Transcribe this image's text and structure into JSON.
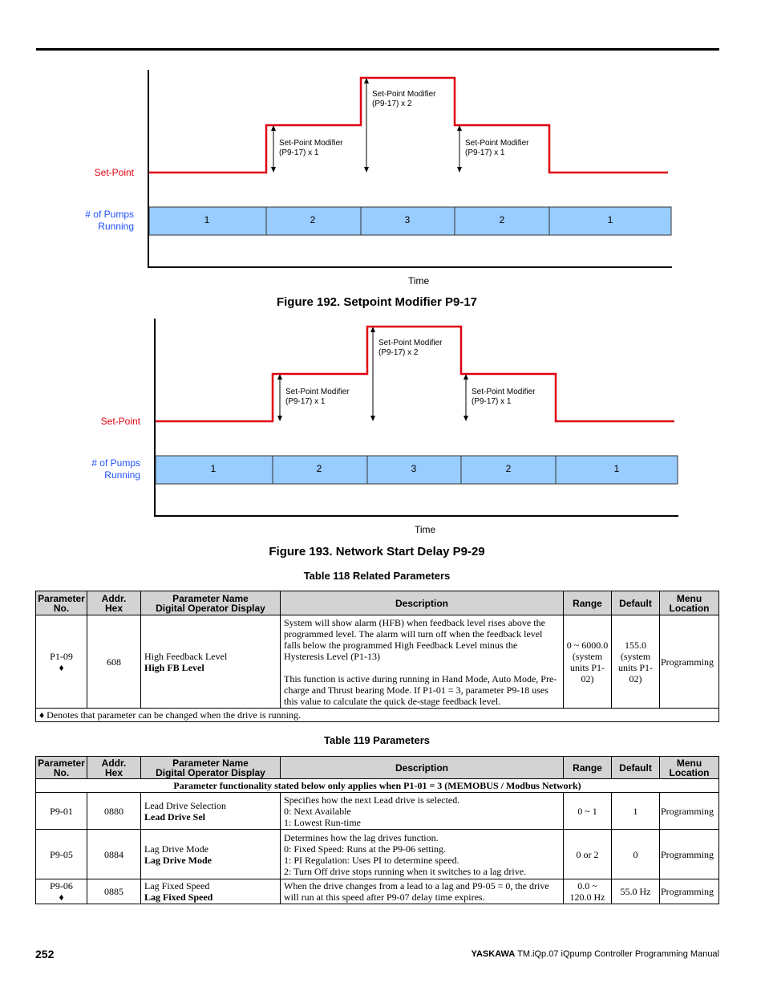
{
  "figures": [
    {
      "setpoint_label": "Set-Point",
      "pumps_label_1": "# of Pumps",
      "pumps_label_2": "Running",
      "modifiers": [
        [
          "Set-Point Modifier",
          "(P9-17) x 1"
        ],
        [
          "Set-Point Modifier",
          "(P9-17) x 2"
        ],
        [
          "Set-Point Modifier",
          "(P9-17) x 1"
        ]
      ],
      "pumps": [
        "1",
        "2",
        "3",
        "2",
        "1"
      ],
      "x_axis": "Time",
      "caption": "Figure 192.   Setpoint Modifier P9-17"
    },
    {
      "setpoint_label": "Set-Point",
      "pumps_label_1": "# of Pumps",
      "pumps_label_2": "Running",
      "modifiers": [
        [
          "Set-Point Modifier",
          "(P9-17) x 1"
        ],
        [
          "Set-Point Modifier",
          "(P9-17) x 2"
        ],
        [
          "Set-Point Modifier",
          "(P9-17) x 1"
        ]
      ],
      "pumps": [
        "1",
        "2",
        "3",
        "2",
        "1"
      ],
      "x_axis": "Time",
      "caption": "Figure 193.   Network Start Delay P9-29"
    }
  ],
  "colors": {
    "setpoint": "#e0000f",
    "pump_bar": "#99ccff",
    "pump_label": "#1f4fff"
  },
  "headers": [
    "Parameter",
    "No.",
    "Addr.",
    "Hex",
    "Parameter Name",
    "Digital Operator Display",
    "Description",
    "Range",
    "Default",
    "Menu",
    "Location"
  ],
  "table118": {
    "caption": "Table 118  Related Parameters",
    "row": {
      "no": "P1-09",
      "mark": "♦",
      "addr": "608",
      "name": "High Feedback Level",
      "display": "High FB Level",
      "desc1": "System will show alarm (HFB) when feedback level rises above the programmed level. The alarm will turn off when the feedback level falls below the programmed High Feedback Level minus the Hysteresis Level (P1-13)",
      "desc2": "This function is active during running in Hand Mode, Auto Mode, Pre-charge and Thrust bearing Mode. If P1-01 = 3, parameter P9-18 uses this value to calculate the quick de-stage feedback level.",
      "range": "0 ~ 6000.0 (system units P1-02)",
      "default": "155.0 (system units P1-02)",
      "menu": "Programming"
    },
    "note": "♦ Denotes that parameter can be changed when the drive is running."
  },
  "table119": {
    "caption": "Table 119  Parameters",
    "banner": "Parameter functionality stated below only applies when P1-01 = 3 (MEMOBUS / Modbus Network)",
    "rows": [
      {
        "no": "P9-01",
        "mark": "",
        "addr": "0880",
        "name": "Lead Drive Selection",
        "display": "Lead Drive Sel",
        "desc": [
          "Specifies how the next Lead drive is selected.",
          "0: Next Available",
          "1: Lowest Run-time"
        ],
        "range": "0 ~ 1",
        "default": "1",
        "menu": "Programming"
      },
      {
        "no": "P9-05",
        "mark": "",
        "addr": "0884",
        "name": "Lag Drive Mode",
        "display": "Lag Drive Mode",
        "desc": [
          "Determines how the lag drives function.",
          "0: Fixed Speed: Runs at the P9-06 setting.",
          "1: PI Regulation: Uses PI to determine speed.",
          "2: Turn Off drive stops running when it switches to a lag drive."
        ],
        "range": "0 or 2",
        "default": "0",
        "menu": "Programming"
      },
      {
        "no": "P9-06",
        "mark": "♦",
        "addr": "0885",
        "name": "Lag Fixed Speed",
        "display": "Lag Fixed Speed",
        "desc": [
          "When the drive changes from a lead to a lag and P9-05 = 0, the drive will run at this speed after P9-07 delay time expires."
        ],
        "range": "0.0 ~ 120.0 Hz",
        "default": "55.0 Hz",
        "menu": "Programming"
      }
    ]
  },
  "footer": {
    "page": "252",
    "brand": "YASKAWA",
    "title": " TM.iQp.07 iQpump Controller Programming Manual"
  }
}
